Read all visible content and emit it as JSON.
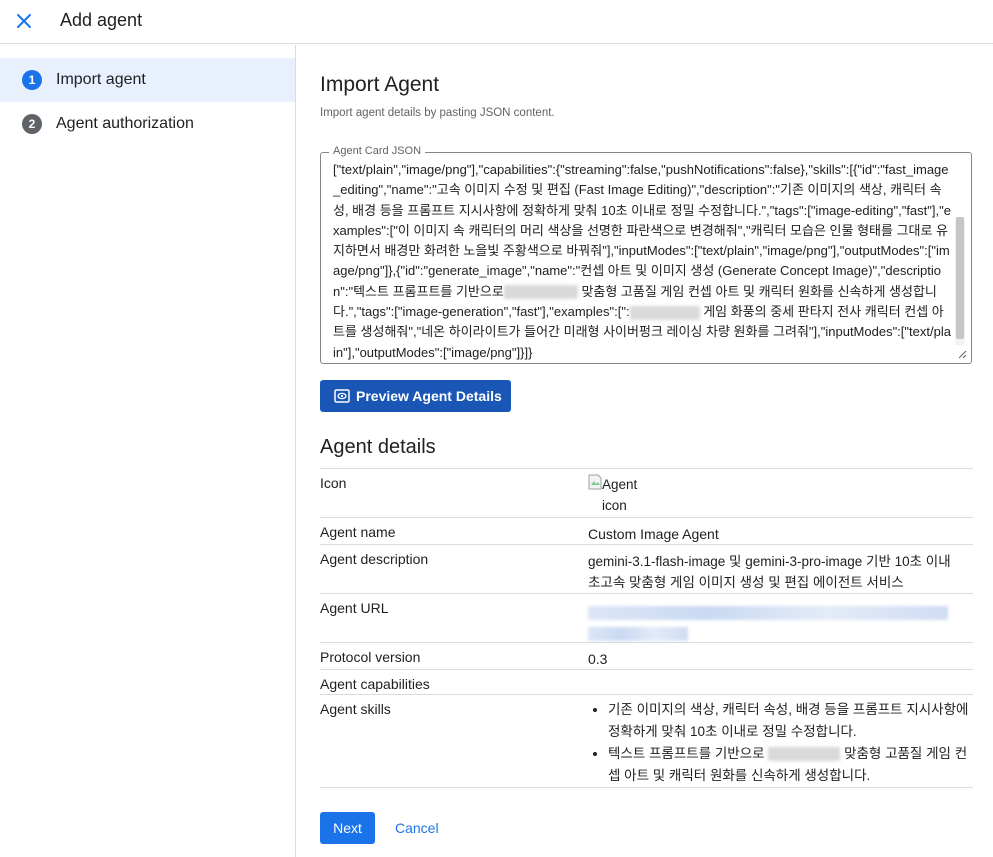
{
  "header": {
    "title": "Add agent",
    "close_icon": "close-icon"
  },
  "sidebar": {
    "steps": [
      {
        "number": "1",
        "label": "Import agent",
        "active": true
      },
      {
        "number": "2",
        "label": "Agent authorization",
        "active": false
      }
    ]
  },
  "main": {
    "title": "Import Agent",
    "subtitle": "Import agent details by pasting JSON content.",
    "json_field": {
      "label": "Agent Card JSON",
      "value_parts": [
        "[\"text/plain\",\"image/png\"],\"capabilities\":{\"streaming\":false,\"pushNotifications\":false},\"skills\":[{\"id\":\"fast_image_editing\",\"name\":\"고속 이미지 수정 및 편집 (Fast Image Editing)\",\"description\":\"기존 이미지의 색상, 캐릭터 속성, 배경 등을 프롬프트 지시사항에 정확하게 맞춰 10초 이내로 정밀 수정합니다.\",\"tags\":[\"image-editing\",\"fast\"],\"examples\":[\"이 이미지 속 캐릭터의 머리 색상을 선명한 파란색으로 변경해줘\",\"캐릭터 모습은 인물 형태를 그대로 유지하면서 배경만 화려한 노을빛 주황색으로 바꿔줘\"],\"inputModes\":[\"text/plain\",\"image/png\"],\"outputModes\":[\"image/png\"]},{\"id\":\"generate_image\",\"name\":\"컨셉 아트 및 이미지 생성 (Generate Concept Image)\",\"description\":\"텍스트 프롬프트를 기반으로",
        " 맞춤형 고품질 게임 컨셉 아트 및 캐릭터 원화를 신속하게 생성합니다.\",\"tags\":[\"image-generation\",\"fast\"],\"examples\":[\":",
        " 게임 화풍의 중세 판타지 전사 캐릭터 컨셉 아트를 생성해줘\",\"네온 하이라이트가 들어간 미래형 사이버펑크 레이싱 차량 원화를 그려줘\"],\"inputModes\":[\"text/plain\"],\"outputModes\":[\"image/png\"]}]}"
      ]
    },
    "preview_button": "Preview Agent Details",
    "details_title": "Agent details",
    "details": {
      "icon_label": "Icon",
      "icon_alt": "Agent icon",
      "name_label": "Agent name",
      "name_value": "Custom Image Agent",
      "description_label": "Agent description",
      "description_value": "gemini-3.1-flash-image 및 gemini-3-pro-image 기반 10초 이내 초고속 맞춤형 게임 이미지 생성 및 편집 에이전트 서비스",
      "url_label": "Agent URL",
      "protocol_label": "Protocol version",
      "protocol_value": "0.3",
      "capabilities_label": "Agent capabilities",
      "skills_label": "Agent skills",
      "skills": [
        {
          "text": "기존 이미지의 색상, 캐릭터 속성, 배경 등을 프롬프트 지시사항에 정확하게 맞춰 10초 이내로 정밀 수정합니다."
        },
        {
          "text_before": "텍스트 프롬프트를 기반으로",
          "text_after": "맞춤형 고품질 게임 컨셉 아트 및 캐릭터 원화를 신속하게 생성합니다."
        }
      ]
    },
    "next_button": "Next",
    "cancel_button": "Cancel"
  },
  "colors": {
    "accent": "#1a73e8",
    "preview_button": "#1a56b5",
    "active_step_bg": "#e8f0fe"
  }
}
